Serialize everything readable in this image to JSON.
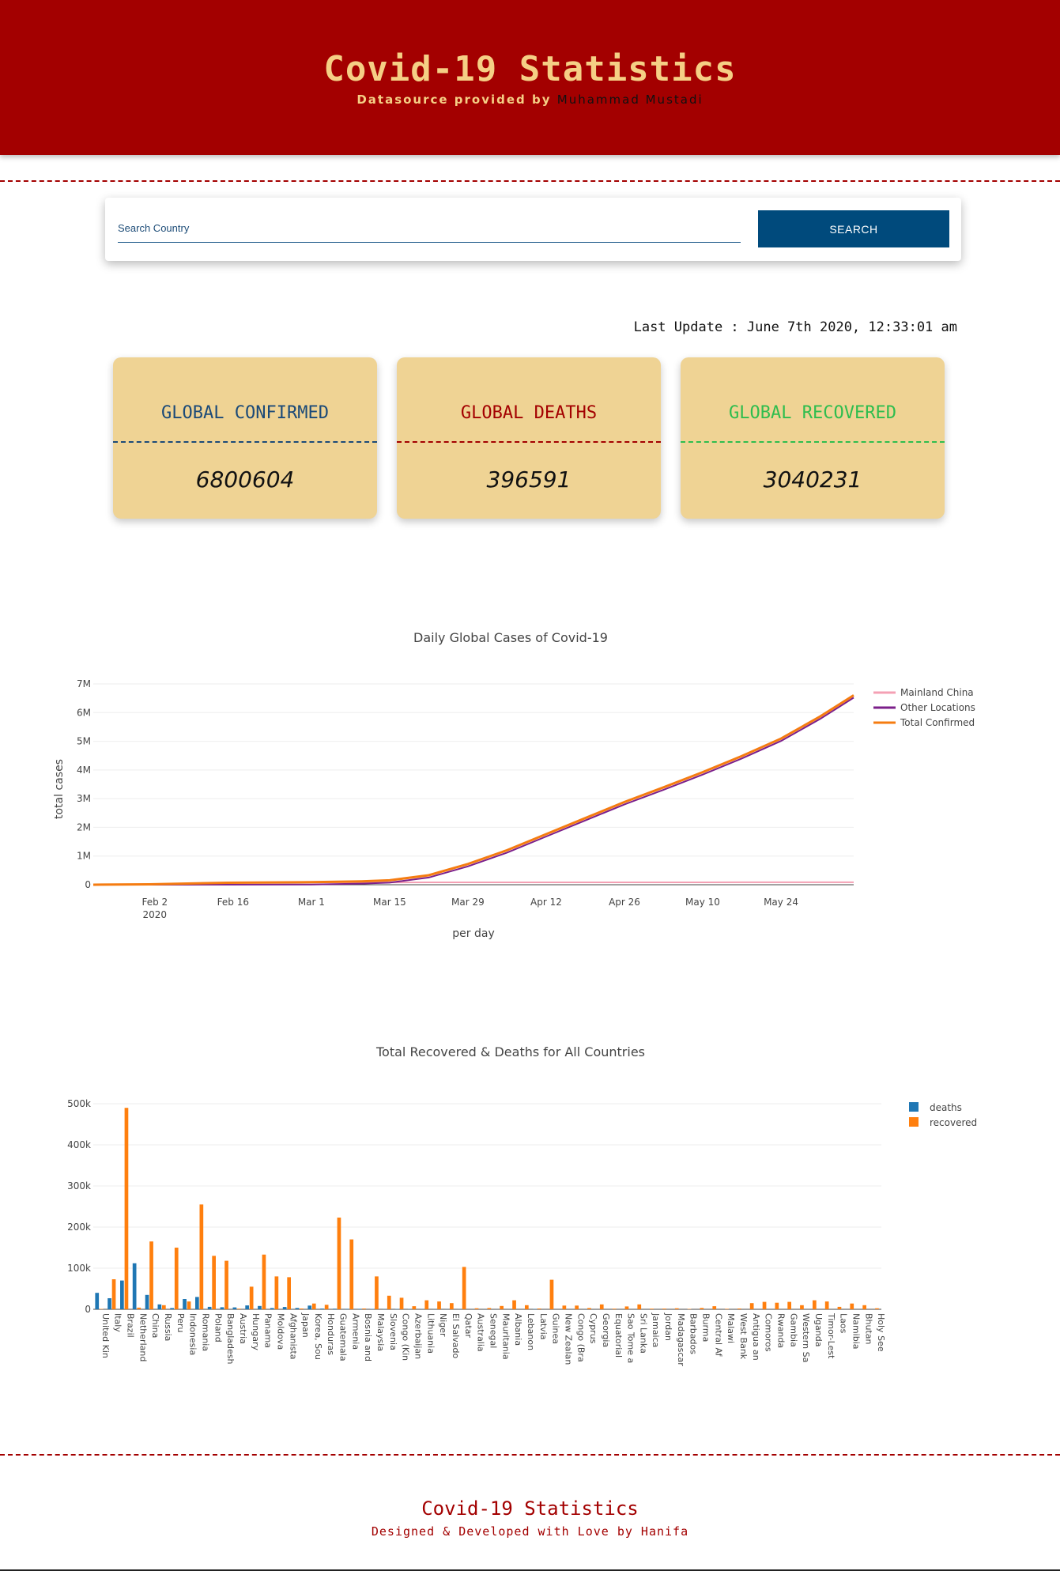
{
  "header": {
    "title": "Covid-19 Statistics",
    "source_prefix": "Datasource provided by ",
    "source_author": "Muhammad Mustadi"
  },
  "search": {
    "placeholder": "Search Country",
    "button_label": "SEARCH"
  },
  "last_update": "Last Update : June 7th 2020, 12:33:01 am",
  "cards": [
    {
      "label": "GLOBAL CONFIRMED",
      "value": "6800604",
      "color": "#1b4a78"
    },
    {
      "label": "GLOBAL DEATHS",
      "value": "396591",
      "color": "#a30000"
    },
    {
      "label": "GLOBAL RECOVERED",
      "value": "3040231",
      "color": "#2ebd4e"
    }
  ],
  "chart_data": [
    {
      "type": "line",
      "title": "Daily Global Cases of Covid-19",
      "xlabel": "per day",
      "ylabel": "total cases",
      "x_ticks": [
        "Feb 2\n2020",
        "Feb 16",
        "Mar 1",
        "Mar 15",
        "Mar 29",
        "Apr 12",
        "Apr 26",
        "May 10",
        "May 24"
      ],
      "y_ticks": [
        "0",
        "1M",
        "2M",
        "3M",
        "4M",
        "5M",
        "6M",
        "7M"
      ],
      "ylim": [
        0,
        7000000
      ],
      "xlim": [
        "2020-01-22",
        "2020-06-06"
      ],
      "legend_position": "top-right",
      "grid": true,
      "x": [
        "2020-01-22",
        "2020-02-01",
        "2020-02-15",
        "2020-03-01",
        "2020-03-10",
        "2020-03-15",
        "2020-03-22",
        "2020-03-29",
        "2020-04-05",
        "2020-04-12",
        "2020-04-19",
        "2020-04-26",
        "2020-05-03",
        "2020-05-10",
        "2020-05-17",
        "2020-05-24",
        "2020-05-31",
        "2020-06-06"
      ],
      "series": [
        {
          "name": "Mainland China",
          "color": "#f4a0b4",
          "values": [
            500,
            11800,
            68000,
            80000,
            80800,
            81000,
            81400,
            81500,
            81700,
            83000,
            83800,
            83900,
            84000,
            84000,
            84100,
            84100,
            84100,
            84200
          ]
        },
        {
          "name": "Other Locations",
          "color": "#7b1f8a",
          "values": [
            50,
            1000,
            1500,
            8000,
            38000,
            72000,
            250000,
            640000,
            1120000,
            1680000,
            2240000,
            2800000,
            3310000,
            3840000,
            4400000,
            5010000,
            5780000,
            6520000
          ]
        },
        {
          "name": "Total Confirmed",
          "color": "#f57c11",
          "values": [
            550,
            12800,
            69500,
            88000,
            119000,
            153000,
            331000,
            722000,
            1202000,
            1763000,
            2324000,
            2884000,
            3394000,
            3924000,
            4484000,
            5094000,
            5864000,
            6604000
          ]
        }
      ]
    },
    {
      "type": "bar",
      "title": "Total Recovered & Deaths for All Countries",
      "ylim": [
        0,
        500000
      ],
      "y_ticks": [
        "0",
        "100k",
        "200k",
        "300k",
        "400k",
        "500k"
      ],
      "legend_position": "top-right",
      "grid": true,
      "tick_labels": [
        "United Kingdom",
        "Italy",
        "Brazil",
        "Netherlands",
        "China",
        "Russia",
        "Peru",
        "Indonesia",
        "Romania",
        "Poland",
        "Bangladesh",
        "Austria",
        "Hungary",
        "Panama",
        "Moldova",
        "Afghanistan",
        "Japan",
        "Korea, South",
        "Honduras",
        "Guatemala",
        "Armenia",
        "Bosnia and Herzegovina",
        "Malaysia",
        "Slovenia",
        "Congo (Kinshasa)",
        "Azerbaijan",
        "Lithuania",
        "Niger",
        "El Salvador",
        "Qatar",
        "Australia",
        "Senegal",
        "Mauritania",
        "Albania",
        "Lebanon",
        "Latvia",
        "Guinea",
        "New Zealand",
        "Congo (Brazzaville)",
        "Cyprus",
        "Georgia",
        "Equatorial Guinea",
        "Sao Tome and Principe",
        "Sri Lanka",
        "Jamaica",
        "Jordan",
        "Madagascar",
        "Barbados",
        "Burma",
        "Central African Republic",
        "Malawi",
        "West Bank and Gaza",
        "Antigua and Barbuda",
        "Comoros",
        "Rwanda",
        "Gambia",
        "Western Sahara",
        "Uganda",
        "Timor-Leste",
        "Laos",
        "Namibia",
        "Bhutan",
        "Holy See"
      ],
      "series": [
        {
          "name": "deaths",
          "color": "#1f77b4",
          "values": [
            40000,
            27000,
            70000,
            112000,
            35000,
            12000,
            3000,
            25000,
            30000,
            6000,
            5000,
            4600,
            9500,
            8000,
            3000,
            5500,
            3300,
            9000,
            1700,
            1500,
            1200,
            1100,
            900,
            500,
            900,
            700,
            550,
            300,
            400,
            300,
            200,
            100,
            100,
            120,
            80,
            700,
            50,
            60,
            130,
            200,
            30,
            30,
            25,
            20,
            15,
            10,
            5,
            5,
            8,
            10,
            5,
            3,
            3,
            2,
            5,
            1,
            1,
            0,
            0,
            0,
            0,
            0,
            0
          ]
        },
        {
          "name": "recovered",
          "color": "#ff7f0e",
          "values": [
            1000,
            73000,
            490000,
            4000,
            165000,
            10000,
            150000,
            19000,
            255000,
            130000,
            118000,
            1500,
            55000,
            133000,
            80000,
            78000,
            2000,
            14000,
            11000,
            223000,
            170000,
            2000,
            80000,
            33000,
            28000,
            7500,
            22000,
            19000,
            15000,
            103000,
            2500,
            3000,
            8000,
            22000,
            10000,
            2000,
            72000,
            9000,
            9000,
            3000,
            12000,
            1500,
            7000,
            12000,
            1600,
            1800,
            2500,
            1000,
            3200,
            7500,
            1200,
            2000,
            15000,
            18000,
            16000,
            18000,
            10000,
            22000,
            19000,
            6000,
            14000,
            10000,
            2500
          ]
        }
      ]
    }
  ],
  "footer": {
    "title": "Covid-19 Statistics",
    "subtitle": "Designed & Developed with Love by Hanifa"
  }
}
